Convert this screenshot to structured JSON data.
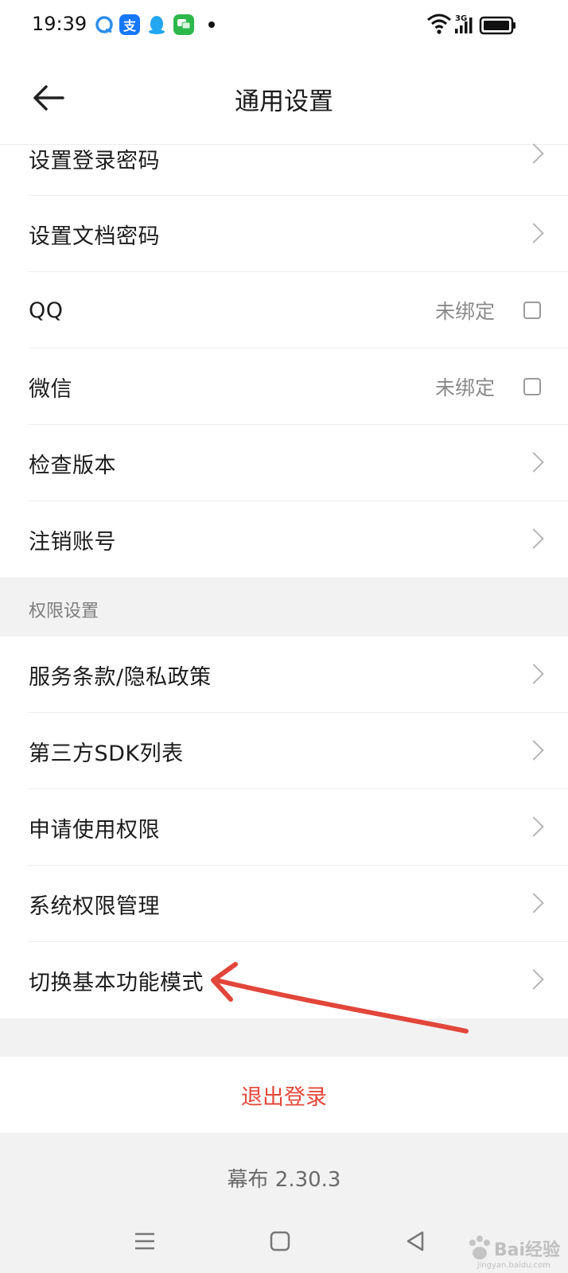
{
  "status_bar": {
    "time": "19:39",
    "network": "3G",
    "app_icons": [
      "browser-icon",
      "alipay-icon",
      "qq-icon",
      "wechat-icon"
    ]
  },
  "header": {
    "title": "通用设置",
    "back_icon": "back-arrow-icon"
  },
  "account_settings": {
    "items": [
      {
        "label": "设置登录密码",
        "type": "link"
      },
      {
        "label": "设置文档密码",
        "type": "link"
      },
      {
        "label": "QQ",
        "status": "未绑定",
        "type": "bind"
      },
      {
        "label": "微信",
        "status": "未绑定",
        "type": "bind"
      },
      {
        "label": "检查版本",
        "type": "link"
      },
      {
        "label": "注销账号",
        "type": "link"
      }
    ]
  },
  "permission_settings": {
    "header": "权限设置",
    "items": [
      {
        "label": "服务条款/隐私政策"
      },
      {
        "label": "第三方SDK列表"
      },
      {
        "label": "申请使用权限"
      },
      {
        "label": "系统权限管理"
      },
      {
        "label": "切换基本功能模式"
      }
    ]
  },
  "logout": {
    "label": "退出登录"
  },
  "version": "幕布 2.30.3",
  "system_nav": [
    "menu-icon",
    "home-icon",
    "back-triangle-icon"
  ],
  "watermark": {
    "text": "Bai经验",
    "sub": "jingyan.baidu.com"
  },
  "colors": {
    "accent_red": "#e5473a",
    "annotation_red": "#e2463b"
  }
}
